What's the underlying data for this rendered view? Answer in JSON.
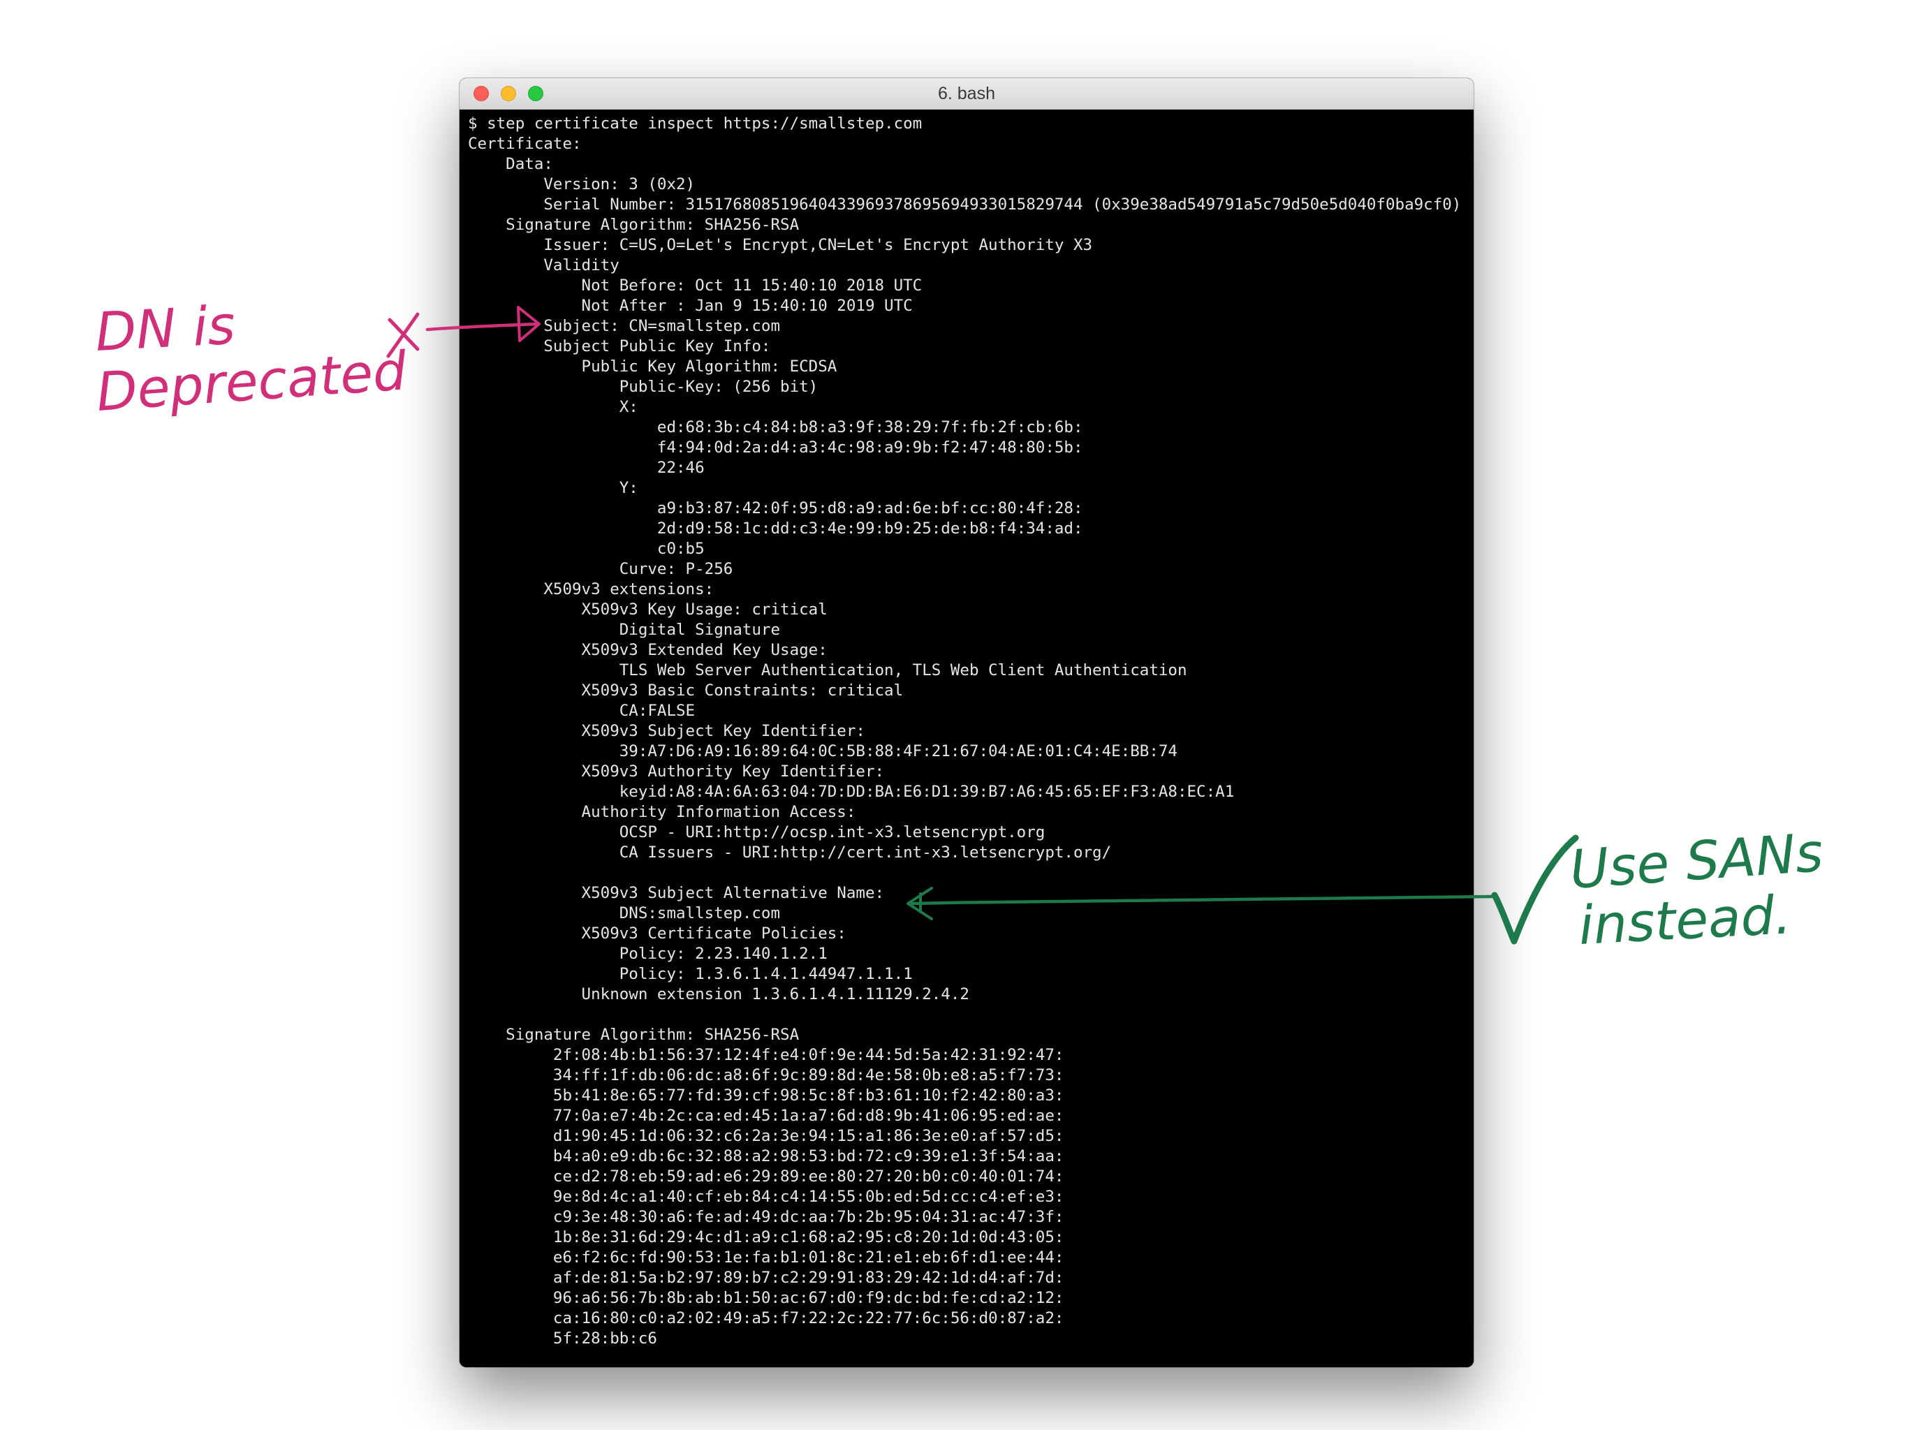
{
  "window": {
    "title": "6. bash"
  },
  "terminal": {
    "output": "$ step certificate inspect https://smallstep.com\nCertificate:\n    Data:\n        Version: 3 (0x2)\n        Serial Number: 315176808519640433969378695694933015829744 (0x39e38ad549791a5c79d50e5d040f0ba9cf0)\n    Signature Algorithm: SHA256-RSA\n        Issuer: C=US,O=Let's Encrypt,CN=Let's Encrypt Authority X3\n        Validity\n            Not Before: Oct 11 15:40:10 2018 UTC\n            Not After : Jan 9 15:40:10 2019 UTC\n        Subject: CN=smallstep.com\n        Subject Public Key Info:\n            Public Key Algorithm: ECDSA\n                Public-Key: (256 bit)\n                X:\n                    ed:68:3b:c4:84:b8:a3:9f:38:29:7f:fb:2f:cb:6b:\n                    f4:94:0d:2a:d4:a3:4c:98:a9:9b:f2:47:48:80:5b:\n                    22:46\n                Y:\n                    a9:b3:87:42:0f:95:d8:a9:ad:6e:bf:cc:80:4f:28:\n                    2d:d9:58:1c:dd:c3:4e:99:b9:25:de:b8:f4:34:ad:\n                    c0:b5\n                Curve: P-256\n        X509v3 extensions:\n            X509v3 Key Usage: critical\n                Digital Signature\n            X509v3 Extended Key Usage:\n                TLS Web Server Authentication, TLS Web Client Authentication\n            X509v3 Basic Constraints: critical\n                CA:FALSE\n            X509v3 Subject Key Identifier:\n                39:A7:D6:A9:16:89:64:0C:5B:88:4F:21:67:04:AE:01:C4:4E:BB:74\n            X509v3 Authority Key Identifier:\n                keyid:A8:4A:6A:63:04:7D:DD:BA:E6:D1:39:B7:A6:45:65:EF:F3:A8:EC:A1\n            Authority Information Access:\n                OCSP - URI:http://ocsp.int-x3.letsencrypt.org\n                CA Issuers - URI:http://cert.int-x3.letsencrypt.org/\n\n            X509v3 Subject Alternative Name:\n                DNS:smallstep.com\n            X509v3 Certificate Policies:\n                Policy: 2.23.140.1.2.1\n                Policy: 1.3.6.1.4.1.44947.1.1.1\n            Unknown extension 1.3.6.1.4.1.11129.2.4.2\n\n    Signature Algorithm: SHA256-RSA\n         2f:08:4b:b1:56:37:12:4f:e4:0f:9e:44:5d:5a:42:31:92:47:\n         34:ff:1f:db:06:dc:a8:6f:9c:89:8d:4e:58:0b:e8:a5:f7:73:\n         5b:41:8e:65:77:fd:39:cf:98:5c:8f:b3:61:10:f2:42:80:a3:\n         77:0a:e7:4b:2c:ca:ed:45:1a:a7:6d:d8:9b:41:06:95:ed:ae:\n         d1:90:45:1d:06:32:c6:2a:3e:94:15:a1:86:3e:e0:af:57:d5:\n         b4:a0:e9:db:6c:32:88:a2:98:53:bd:72:c9:39:e1:3f:54:aa:\n         ce:d2:78:eb:59:ad:e6:29:89:ee:80:27:20:b0:c0:40:01:74:\n         9e:8d:4c:a1:40:cf:eb:84:c4:14:55:0b:ed:5d:cc:c4:ef:e3:\n         c9:3e:48:30:a6:fe:ad:49:dc:aa:7b:2b:95:04:31:ac:47:3f:\n         1b:8e:31:6d:29:4c:d1:a9:c1:68:a2:95:c8:20:1d:0d:43:05:\n         e6:f2:6c:fd:90:53:1e:fa:b1:01:8c:21:e1:eb:6f:d1:ee:44:\n         af:de:81:5a:b2:97:89:b7:c2:29:91:83:29:42:1d:d4:af:7d:\n         96:a6:56:7b:8b:ab:b1:50:ac:67:d0:f9:dc:bd:fe:cd:a2:12:\n         ca:16:80:c0:a2:02:49:a5:f7:22:2c:22:77:6c:56:d0:87:a2:\n         5f:28:bb:c6",
    "prompt": "$"
  },
  "annotations": {
    "deprecated_note": {
      "line1": "DN is",
      "line2": "Deprecated",
      "mark": "X",
      "color": "#d0307a"
    },
    "san_note": {
      "line1": "Use SANs",
      "line2": "instead.",
      "mark": "check-mark",
      "color": "#1e7a4a"
    }
  },
  "icons": {
    "close": "close-button-icon",
    "minimize": "minimize-button-icon",
    "zoom": "zoom-button-icon",
    "cursor": "block-cursor-icon"
  },
  "colors": {
    "terminal_bg": "#000000",
    "terminal_fg": "#e6e6e6",
    "close": "#fc5f57",
    "minimize": "#fdbc2e",
    "zoom": "#28c840"
  }
}
